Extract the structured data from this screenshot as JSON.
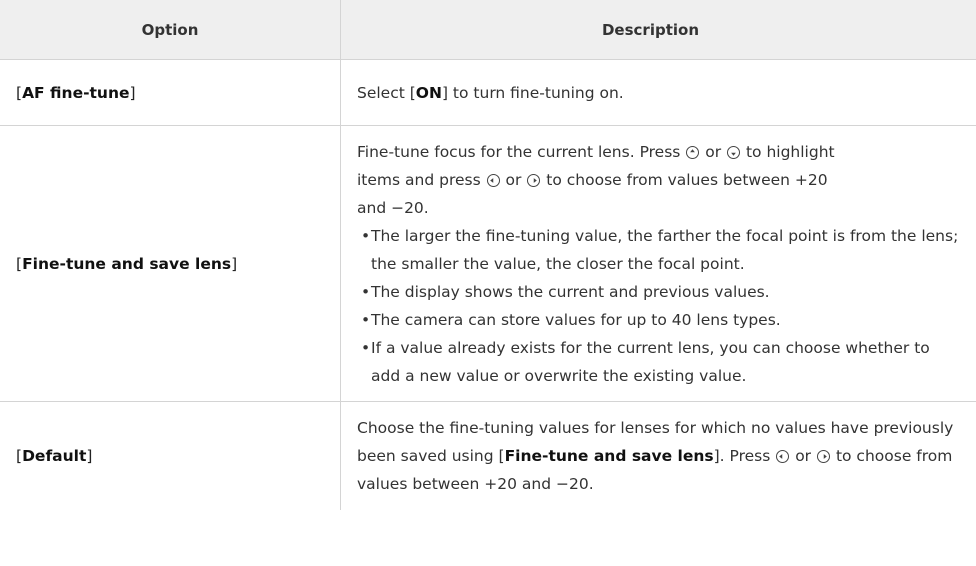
{
  "table": {
    "headers": {
      "option": "Option",
      "description": "Description"
    },
    "rows": [
      {
        "option_prefix": "[",
        "option_bold": "AF fine-tune",
        "option_suffix": "]",
        "desc_parts": [
          "Select [",
          "ON",
          "] to turn fine-tuning on."
        ]
      },
      {
        "option_prefix": "[",
        "option_bold": "Fine-tune and save lens",
        "option_suffix": "]",
        "desc_line1a": "Fine-tune focus for the current lens. Press",
        "desc_line1b": "or",
        "desc_line1c": "to highlight",
        "desc_line2a": "items and press",
        "desc_line2b": "or",
        "desc_line2c": "to choose from values between +20",
        "desc_line3": "and −20.",
        "bullets": [
          "The larger the fine-tuning value, the farther the focal point is from the lens; the smaller the value, the closer the focal point.",
          "The display shows the current and previous values.",
          "The camera can store values for up to 40 lens types.",
          "If a value already exists for the current lens, you can choose whether to add a new value or overwrite the existing value."
        ]
      },
      {
        "option_prefix": "[",
        "option_bold": "Default",
        "option_suffix": "]",
        "desc_a": "Choose the fine-tuning values for lenses for which no values have previously been saved using [",
        "desc_bold": "Fine-tune and save lens",
        "desc_b": "].",
        "desc_c": "Press",
        "desc_d": "or",
        "desc_e": "to choose from values between +20 and −20."
      }
    ]
  },
  "icons": {
    "up": "multi-selector-up-icon",
    "down": "multi-selector-down-icon",
    "left": "multi-selector-left-icon",
    "right": "multi-selector-right-icon"
  }
}
